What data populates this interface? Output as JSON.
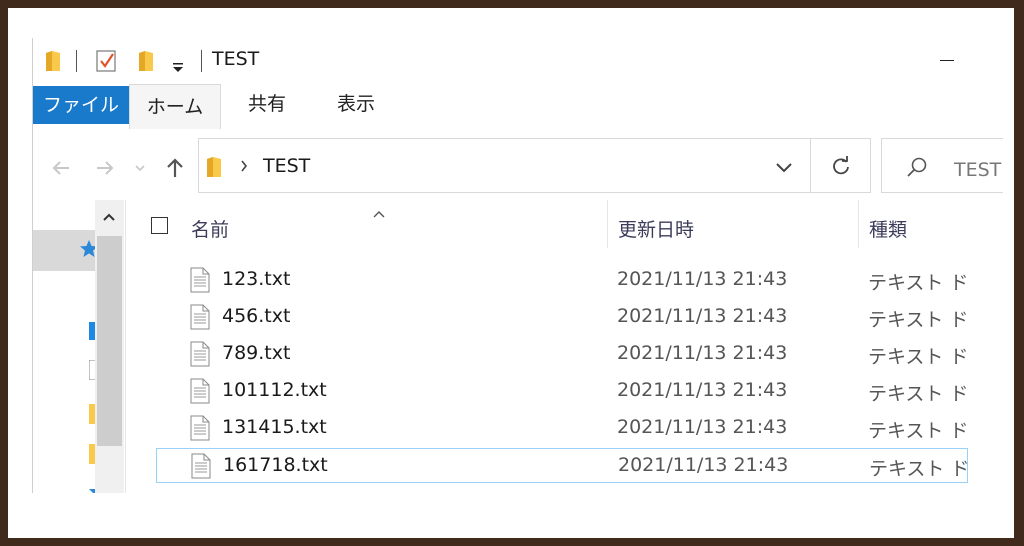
{
  "window": {
    "title": "TEST"
  },
  "ribbon": {
    "tabs": [
      {
        "label": "ファイル"
      },
      {
        "label": "ホーム"
      },
      {
        "label": "共有"
      },
      {
        "label": "表示"
      }
    ]
  },
  "address": {
    "path": "TEST",
    "search_placeholder": "TESTの検索"
  },
  "filelist": {
    "columns": {
      "name": "名前",
      "date": "更新日時",
      "type": "種類"
    },
    "rows": [
      {
        "name": "123.txt",
        "date": "2021/11/13 21:43",
        "type": "テキスト ドキュメント"
      },
      {
        "name": "456.txt",
        "date": "2021/11/13 21:43",
        "type": "テキスト ドキュメント"
      },
      {
        "name": "789.txt",
        "date": "2021/11/13 21:43",
        "type": "テキスト ドキュメント"
      },
      {
        "name": "101112.txt",
        "date": "2021/11/13 21:43",
        "type": "テキスト ドキュメント"
      },
      {
        "name": "131415.txt",
        "date": "2021/11/13 21:43",
        "type": "テキスト ドキュメント"
      },
      {
        "name": "161718.txt",
        "date": "2021/11/13 21:43",
        "type": "テキスト ドキュメント"
      }
    ]
  },
  "colors": {
    "file_tab": "#1979ca",
    "folder": "#f8c94a",
    "selection_border": "#99d1f7",
    "frame": "#3f2a1c"
  },
  "icons": [
    "folder-icon",
    "properties-icon",
    "new-folder-icon",
    "back-icon",
    "forward-icon",
    "up-icon",
    "refresh-icon",
    "search-icon",
    "text-file-icon",
    "quick-access-star-icon"
  ]
}
